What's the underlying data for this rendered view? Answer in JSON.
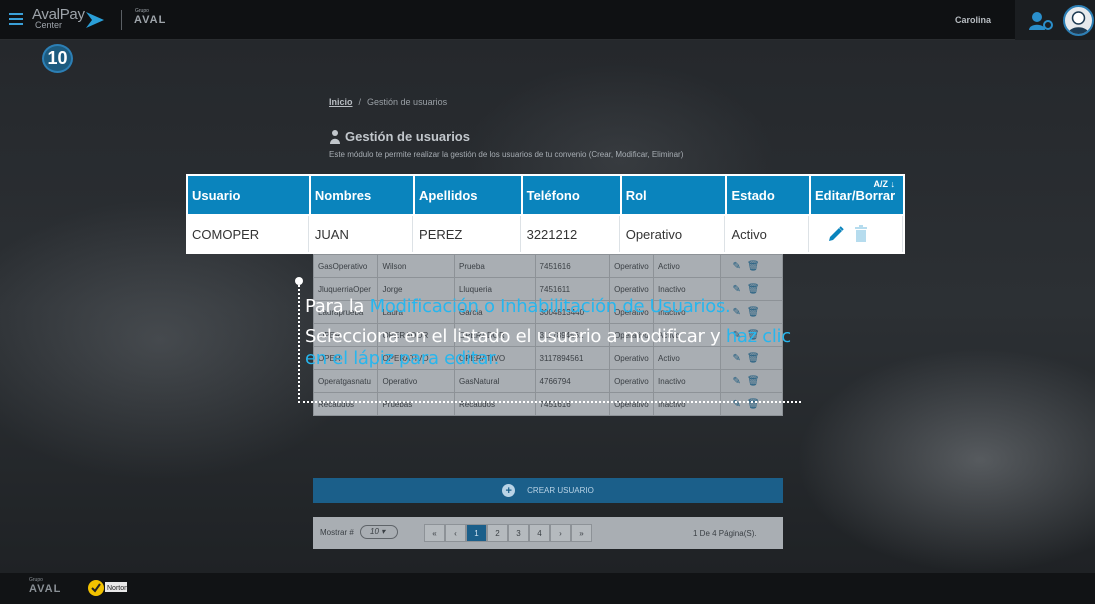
{
  "header": {
    "logo_line1": "AvalPay",
    "logo_line2": "Center",
    "group_small": "Grupo",
    "group_name": "AVAL",
    "user_name": "Carolina"
  },
  "step_number": "10",
  "breadcrumb": {
    "home": "Inicio",
    "current": "Gestión de usuarios"
  },
  "page": {
    "title": "Gestión de usuarios",
    "subtitle": "Este módulo te permite realizar la gestión de los usuarios de tu convenio (Crear, Modificar, Eliminar)"
  },
  "highlight_table": {
    "headers": [
      "Usuario",
      "Nombres",
      "Apellidos",
      "Teléfono",
      "Rol",
      "Estado",
      "Editar/Borrar"
    ],
    "sort_label": "A/Z ↓",
    "row": [
      "COMOPER",
      "JUAN",
      "PEREZ",
      "3221212",
      "Operativo",
      "Activo"
    ]
  },
  "dim_rows": [
    [
      "GasOperativo",
      "Wilson",
      "Prueba",
      "7451616",
      "Operativo",
      "Activo"
    ],
    [
      "JluquerriaOper",
      "Jorge",
      "Lluqueria",
      "7451611",
      "Operativo",
      "Inactivo"
    ],
    [
      "Lauraprueba",
      "Laura",
      "Garcia",
      "3004813440",
      "Operativo",
      "Inactivo"
    ],
    [
      "OPER",
      "OPERADOR",
      "OPERADOR",
      "3117894561",
      "Operativo",
      "Activo"
    ],
    [
      "OPER",
      "OPERATIVO",
      "OPERATIVO",
      "3117894561",
      "Operativo",
      "Activo"
    ],
    [
      "Operatgasnatu",
      "Operativo",
      "GasNatural",
      "4766794",
      "Operativo",
      "Inactivo"
    ],
    [
      "Recaudos",
      "Pruebas",
      "Recaudos",
      "7451616",
      "Operativo",
      "Inactivo"
    ]
  ],
  "create_button": "CREAR USUARIO",
  "pager": {
    "show_label": "Mostrar #",
    "page_size": "10",
    "pages": [
      "«",
      "‹",
      "1",
      "2",
      "3",
      "4",
      "›",
      "»"
    ],
    "active_page": "1",
    "info": "1 De 4 Página(S)."
  },
  "callout": {
    "p1_pre": "Para la ",
    "p1_hl": "Modificación o Inhabilitación de Usuarios.",
    "p2_pre": "Selecciona en el listado el usuario a modificar y ",
    "p2_hl": "haz clic en el lápiz para editar."
  },
  "footer": {
    "group_small": "Grupo",
    "group_name": "AVAL",
    "norton_label": "Norton"
  },
  "colors": {
    "accent": "#0a84bd",
    "highlight_text": "#27b6ee",
    "header_bg": "#0f1113"
  }
}
